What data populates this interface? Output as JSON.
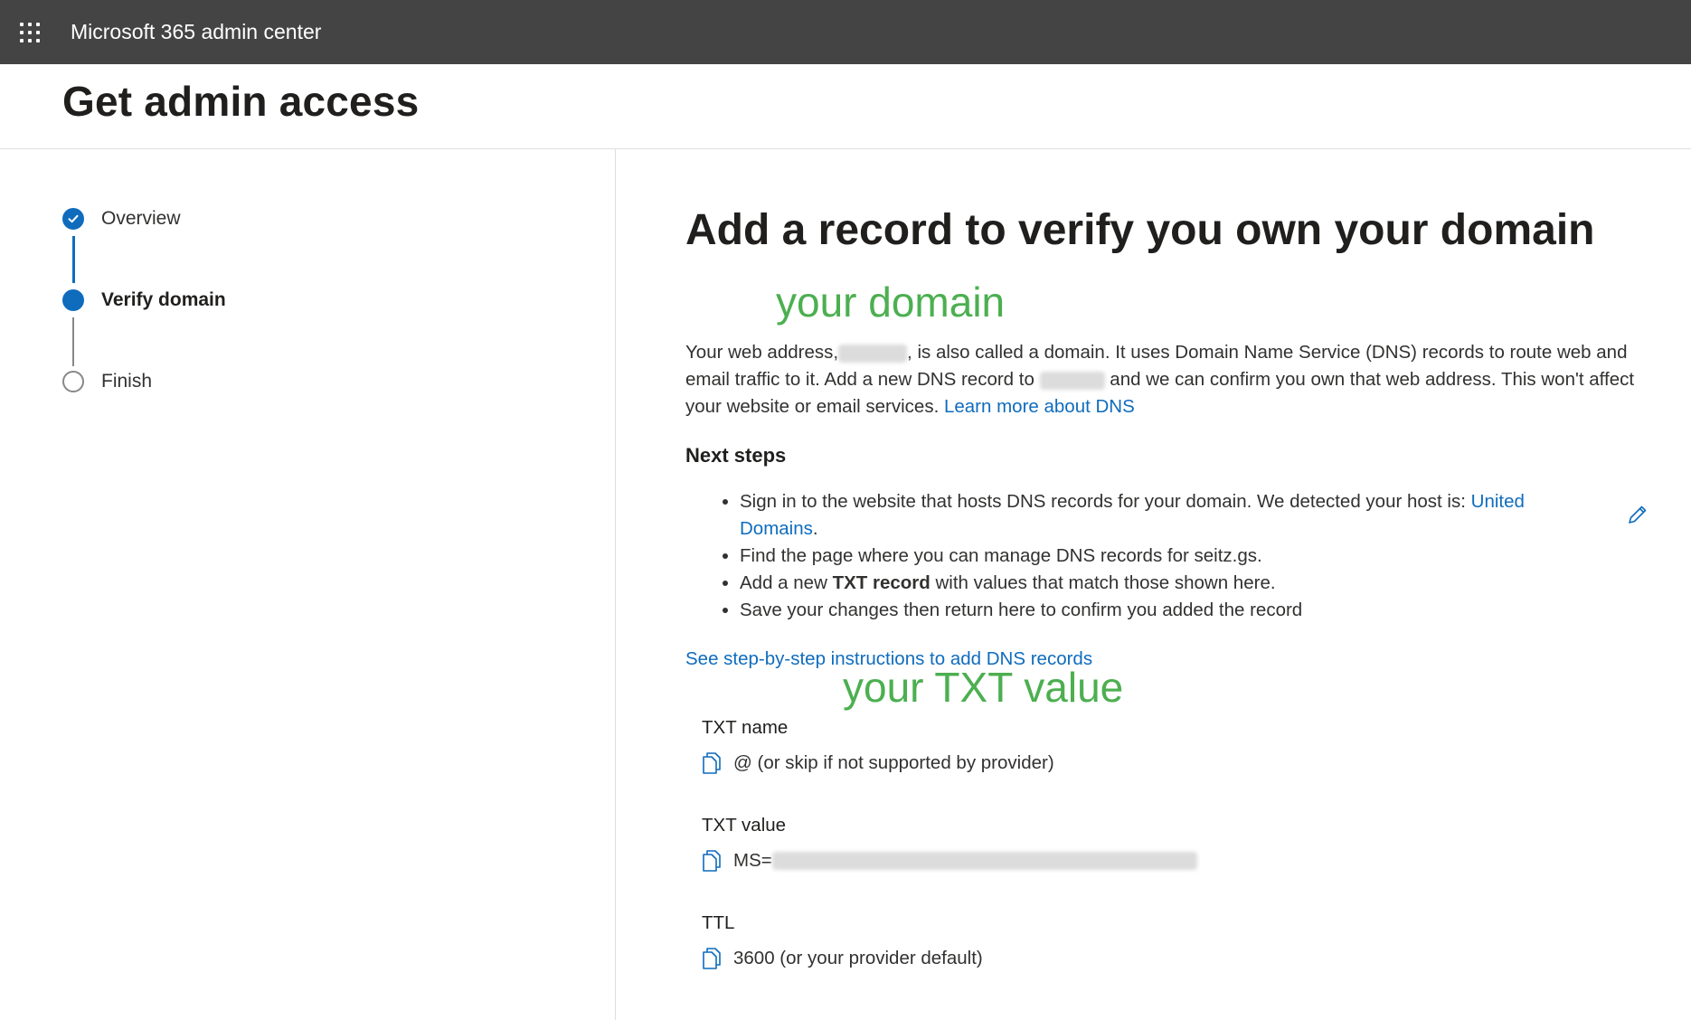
{
  "header": {
    "app_title": "Microsoft 365 admin center",
    "launcher_icon": "app-launcher-waffle-icon",
    "background_color": "#444444"
  },
  "page": {
    "title": "Get admin access"
  },
  "wizard": {
    "steps": [
      {
        "label": "Overview",
        "state": "completed"
      },
      {
        "label": "Verify domain",
        "state": "current"
      },
      {
        "label": "Finish",
        "state": "not-started"
      }
    ],
    "accent_color": "#0f6cbd"
  },
  "main": {
    "title": "Add a record to verify you own your domain",
    "annotation_domain": "your domain",
    "annotation_txt": "your TXT value",
    "annotation_color": "#4caf50",
    "intro_part1": "Your web address,",
    "intro_part2": ", is also called a domain. It uses Domain Name Service (DNS) records to route web and email traffic to it. Add a new DNS record to",
    "intro_part3": "and we can confirm you own that web address. This won't affect your website or email services.",
    "learn_more_link": "Learn more about DNS",
    "next_steps_heading": "Next steps",
    "steps": {
      "s1_text": "Sign in to the website that hosts DNS records for your domain. We detected your host is:",
      "s1_link": "United Domains",
      "s1_end": ".",
      "s2_text": "Find the page where you can manage DNS records for seitz.gs.",
      "s3_pre": "Add a new",
      "s3_bold": "TXT record",
      "s3_post": "with values that match those shown here.",
      "s4_text": "Save your changes then return here to confirm you added the record"
    },
    "edit_icon": "pencil-edit-icon",
    "instructions_link": "See step-by-step instructions to add DNS records",
    "records": {
      "txt_name_label": "TXT name",
      "txt_name_value": "@ (or skip if not supported by provider)",
      "txt_value_label": "TXT value",
      "txt_value_prefix": "MS=",
      "ttl_label": "TTL",
      "ttl_value": "3600 (or your provider default)",
      "copy_icon": "copy-icon"
    }
  }
}
